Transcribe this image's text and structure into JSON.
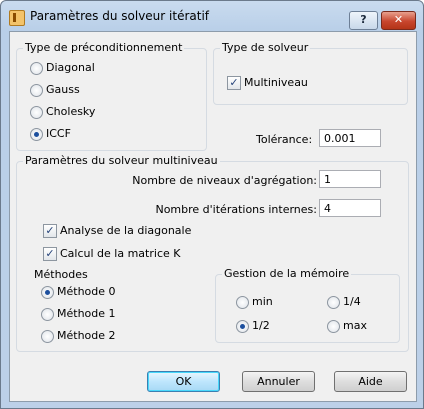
{
  "window": {
    "title": "Paramètres du solveur itératif",
    "help_label": "?",
    "close_label": "✕"
  },
  "preconditioning": {
    "title": "Type de préconditionnement",
    "options": [
      {
        "label": "Diagonal",
        "selected": false
      },
      {
        "label": "Gauss",
        "selected": false
      },
      {
        "label": "Cholesky",
        "selected": false
      },
      {
        "label": "ICCF",
        "selected": true
      }
    ]
  },
  "solver_type": {
    "title": "Type de solveur",
    "multilevel_label": "Multiniveau",
    "multilevel_checked": true
  },
  "tolerance": {
    "label": "Tolérance:",
    "value": "0.001"
  },
  "multilevel": {
    "title": "Paramètres du solveur multiniveau",
    "levels_label": "Nombre de niveaux d'agrégation:",
    "levels_value": "1",
    "iterations_label": "Nombre d'itérations internes:",
    "iterations_value": "4",
    "diag_label": "Analyse de la diagonale",
    "diag_checked": true,
    "matrix_label": "Calcul de la matrice K",
    "matrix_checked": true
  },
  "methods": {
    "title": "Méthodes",
    "options": [
      {
        "label": "Méthode 0",
        "selected": true
      },
      {
        "label": "Méthode 1",
        "selected": false
      },
      {
        "label": "Méthode 2",
        "selected": false
      }
    ]
  },
  "memory": {
    "title": "Gestion de la mémoire",
    "options": [
      {
        "label": "min",
        "selected": false
      },
      {
        "label": "1/4",
        "selected": false
      },
      {
        "label": "1/2",
        "selected": true
      },
      {
        "label": "max",
        "selected": false
      }
    ]
  },
  "buttons": {
    "ok": "OK",
    "cancel": "Annuler",
    "help": "Aide"
  },
  "check_mark": "✓"
}
